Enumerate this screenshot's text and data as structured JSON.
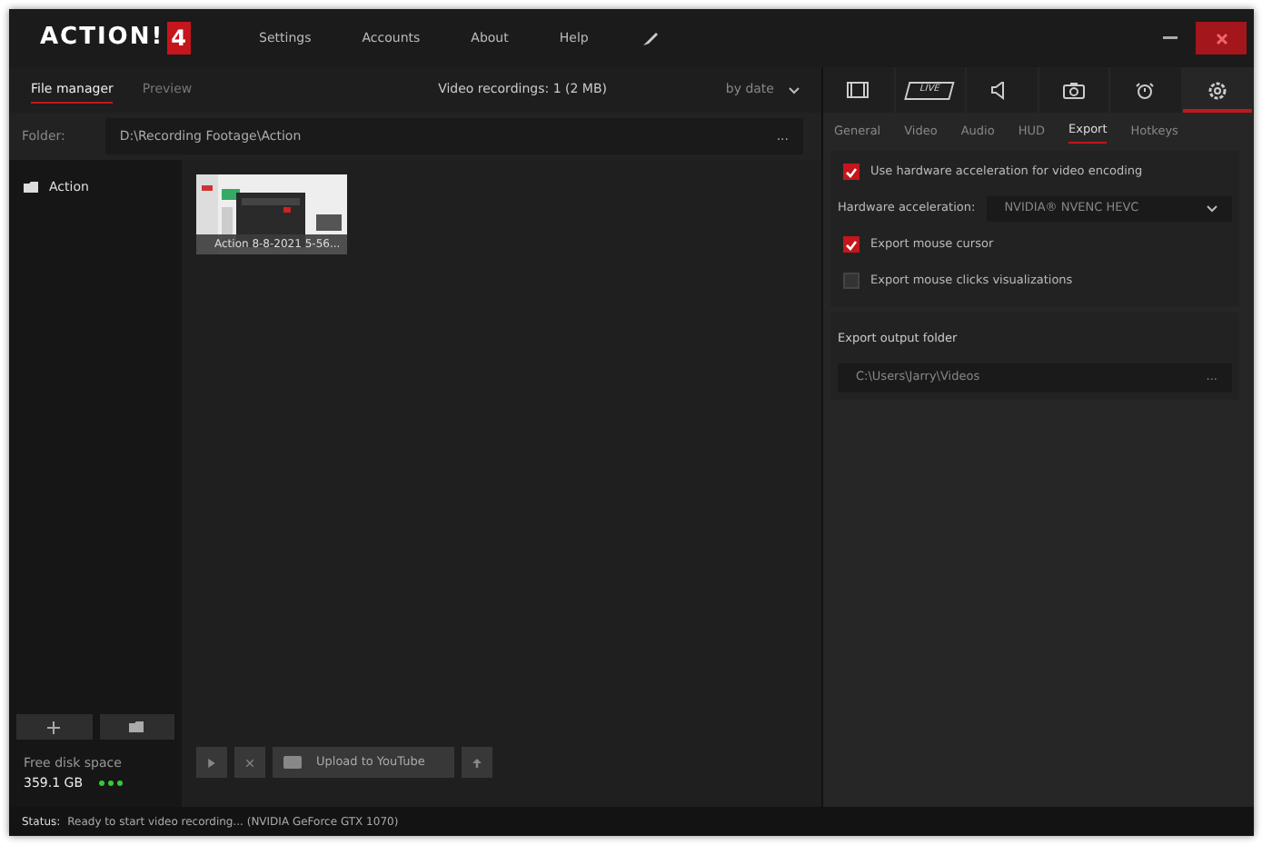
{
  "window": {
    "logo": "ACTION!",
    "logo_badge": "4",
    "menu": [
      "Settings",
      "Accounts",
      "About",
      "Help"
    ]
  },
  "view_tabs": [
    {
      "label": "File manager",
      "selected": true
    },
    {
      "label": "Preview",
      "selected": false
    }
  ],
  "recordings_summary": "Video recordings: 1 (2 MB)",
  "sort": {
    "value": "by date"
  },
  "folder": {
    "label": "Folder:",
    "value": "D:\\Recording Footage\\Action",
    "browse": "..."
  },
  "sidebar": {
    "items": [
      {
        "label": "Action",
        "selected": false
      }
    ],
    "disk_label": "Free disk space",
    "disk_value": "359.1 GB"
  },
  "files": [
    {
      "kind": "picture",
      "caption": "Action 8-8-2021 5-56..."
    }
  ],
  "actions": [
    {
      "kind": "play",
      "disabled": true
    },
    {
      "kind": "delete",
      "disabled": true
    },
    {
      "kind": "youtube",
      "label": "Upload to YouTube",
      "disabled": true
    },
    {
      "kind": "upload",
      "disabled": true
    }
  ],
  "mode_tabs": [
    {
      "kind": "video",
      "selected": false
    },
    {
      "kind": "live",
      "label": "LIVE",
      "selected": false
    },
    {
      "kind": "audio",
      "selected": false
    },
    {
      "kind": "screenshot",
      "selected": false
    },
    {
      "kind": "timer",
      "selected": false
    },
    {
      "kind": "settings",
      "selected": true
    }
  ],
  "settings_tabs": [
    {
      "label": "General",
      "selected": false
    },
    {
      "label": "Video",
      "selected": false
    },
    {
      "label": "Audio",
      "selected": false
    },
    {
      "label": "HUD",
      "selected": false
    },
    {
      "label": "Export",
      "selected": true
    },
    {
      "label": "Hotkeys",
      "selected": false
    }
  ],
  "settings": [
    {
      "kind": "checkbox",
      "label": "Use hardware acceleration for video encoding",
      "checked": true
    },
    {
      "kind": "select",
      "label": "Hardware acceleration:",
      "value": "NVIDIA® NVENC HEVC"
    },
    {
      "kind": "checkbox",
      "label": "Export mouse cursor",
      "checked": true
    },
    {
      "kind": "checkbox",
      "label": "Export mouse clicks visualizations",
      "checked": false
    }
  ],
  "output": {
    "title": "Export output folder",
    "value": "C:\\Users\\Jarry\\Videos",
    "browse": "..."
  },
  "status_bar": {
    "label": "Status:",
    "text": "Ready to start video recording... (NVIDIA GeForce GTX 1070)"
  }
}
